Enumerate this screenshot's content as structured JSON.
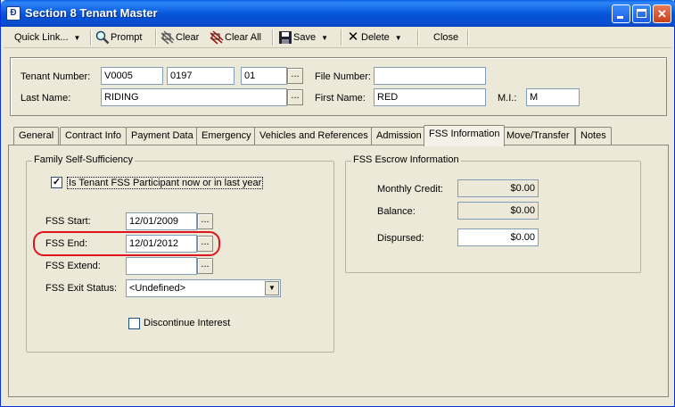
{
  "window": {
    "title": "Section 8 Tenant Master"
  },
  "toolbar": {
    "quick_link": "Quick Link...",
    "prompt": "Prompt",
    "clear": "Clear",
    "clear_all": "Clear All",
    "save": "Save",
    "delete": "Delete",
    "close": "Close"
  },
  "header": {
    "tenant_number_label": "Tenant Number:",
    "tenant_number_1": "V0005",
    "tenant_number_2": "0197",
    "tenant_number_3": "01",
    "file_number_label": "File Number:",
    "file_number": "",
    "last_name_label": "Last Name:",
    "last_name": "RIDING",
    "first_name_label": "First Name:",
    "first_name": "RED",
    "mi_label": "M.I.:",
    "mi": "M"
  },
  "tabs": [
    {
      "label": "General"
    },
    {
      "label": "Contract Info"
    },
    {
      "label": "Payment Data"
    },
    {
      "label": "Emergency"
    },
    {
      "label": "Vehicles and References"
    },
    {
      "label": "Admission"
    },
    {
      "label": "FSS Information",
      "active": true
    },
    {
      "label": "Move/Transfer"
    },
    {
      "label": "Notes"
    }
  ],
  "fss": {
    "group_title": "Family Self-Sufficiency",
    "participant_label": "Is Tenant FSS Participant now or in last year",
    "participant_checked": true,
    "start_label": "FSS Start:",
    "start_value": "12/01/2009",
    "end_label": "FSS End:",
    "end_value": "12/01/2012",
    "extend_label": "FSS Extend:",
    "extend_value": "",
    "exit_status_label": "FSS Exit Status:",
    "exit_status_value": "<Undefined>",
    "discontinue_label": "Discontinue Interest",
    "discontinue_checked": false
  },
  "escrow": {
    "group_title": "FSS Escrow Information",
    "monthly_credit_label": "Monthly Credit:",
    "monthly_credit_value": "$0.00",
    "balance_label": "Balance:",
    "balance_value": "$0.00",
    "dispursed_label": "Dispursed:",
    "dispursed_value": "$0.00"
  },
  "colors": {
    "title_bar": "#0a5fe8",
    "highlight": "#e0141c",
    "face": "#ece9d8"
  }
}
